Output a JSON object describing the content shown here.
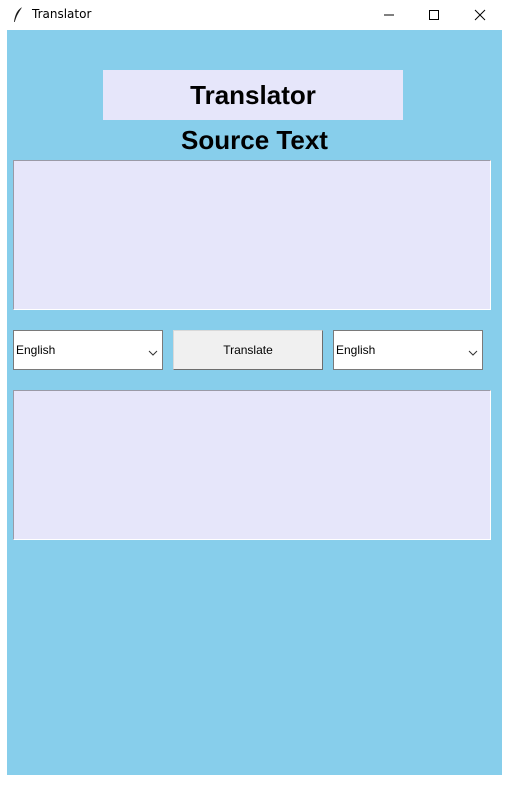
{
  "window": {
    "title": "Translator",
    "icon": "feather-icon",
    "controls": [
      "minimize-icon",
      "maximize-icon",
      "close-icon"
    ]
  },
  "app": {
    "heading": "Translator",
    "source_label": "Source Text",
    "source_text": "",
    "target_text": "",
    "source_language": "English",
    "target_language": "English",
    "translate_label": "Translate",
    "colors": {
      "background": "#87ceeb",
      "panel": "#e6e6fa",
      "button": "#f0f0f0"
    }
  }
}
